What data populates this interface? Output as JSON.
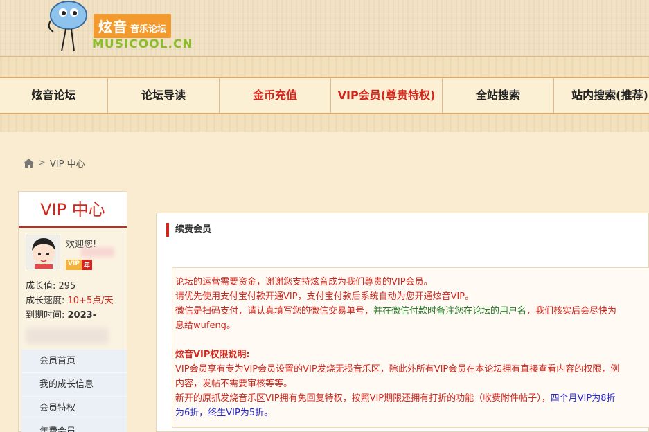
{
  "logo": {
    "cn_text": "炫音",
    "cn_small": "音乐论坛",
    "en_text": "MUSICOOL.CN"
  },
  "nav": {
    "items": [
      {
        "label": "炫音论坛"
      },
      {
        "label": "论坛导读"
      },
      {
        "label": "金币充值"
      },
      {
        "label": "VIP会员(尊贵特权)"
      },
      {
        "label": "全站搜索"
      },
      {
        "label": "站内搜索(推荐)"
      }
    ]
  },
  "breadcrumb": {
    "sep": ">",
    "current": "VIP 中心"
  },
  "sidebar": {
    "title": "VIP 中心",
    "welcome": "欢迎您!",
    "badge_vip": "VIP",
    "badge_year": "年",
    "growth_label": "成长值: ",
    "growth_value": "295",
    "speed_label": "成长速度: ",
    "speed_value": "10+5点/天",
    "expire_label": "到期时间: ",
    "expire_value": "2023-",
    "menu": [
      {
        "label": "会员首页"
      },
      {
        "label": "我的成长信息"
      },
      {
        "label": "会员特权"
      },
      {
        "label": "年费会员"
      }
    ]
  },
  "main": {
    "panel_title": "续费会员",
    "notice": {
      "line1": "论坛的运营需要资金，谢谢您支持炫音成为我们尊贵的VIP会员。",
      "line2": "请优先使用支付宝付款开通VIP，支付宝付款后系统自动为您开通炫音VIP。",
      "line3a": "微信是扫码支付，请认真填写您的微信交易单号，",
      "line3b": "并在微信付款时备注您在论坛的用户名",
      "line3c": "，我们核实后会尽快为",
      "line4": "息给wufeng。",
      "heading": "炫音VIP权限说明:",
      "line5": "VIP会员享有专为VIP会员设置的VIP发烧无损音乐区，除此外所有VIP会员在本论坛拥有直接查看内容的权限，例",
      "line6": "内容，发帖不需要审核等等。",
      "line7a": "新开的原抓发烧音乐区VIP拥有免回复特权，按照VIP期限还拥有打折的功能（收费附件帖子），",
      "line7b": "四个月VIP为8折",
      "line8": "为6折，终生VIP为5折。"
    }
  },
  "colors": {
    "accent_red": "#d2261c",
    "background": "#f9ecd2"
  }
}
